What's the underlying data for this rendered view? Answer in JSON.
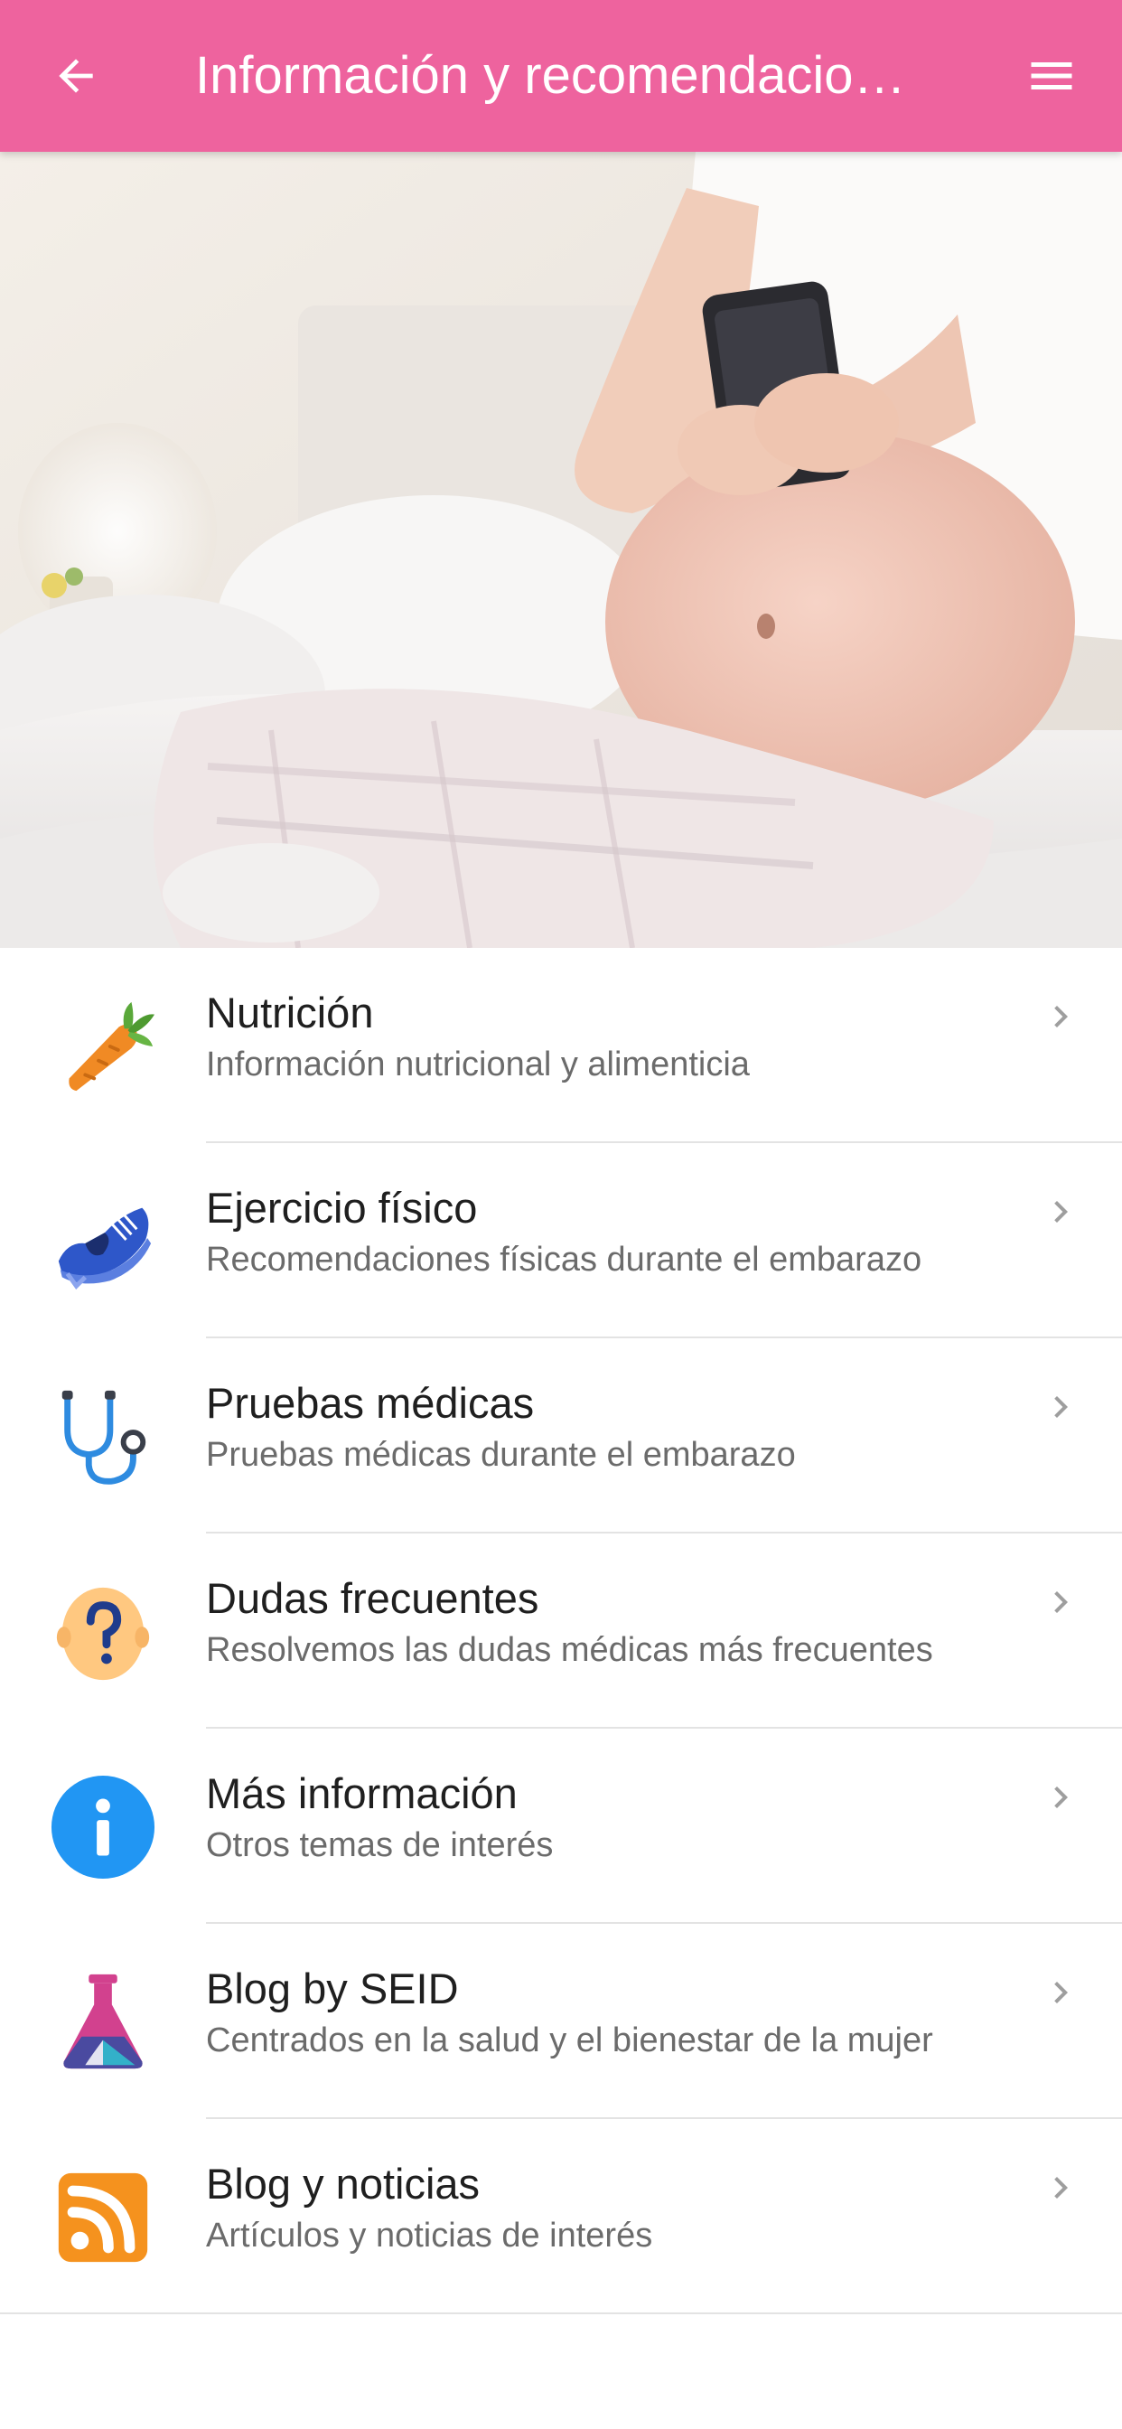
{
  "appbar": {
    "title": "Información y recomendaciones",
    "back_icon": "arrow-back-icon",
    "menu_icon": "hamburger-menu-icon",
    "color": "#EE639E"
  },
  "hero": {
    "subject": "pregnant woman sitting on bed using smartphone"
  },
  "items": [
    {
      "title": "Nutrición",
      "subtitle": "Información nutricional y alimenticia",
      "icon": "carrot-icon"
    },
    {
      "title": "Ejercicio físico",
      "subtitle": "Recomendaciones físicas durante el embarazo",
      "icon": "sneaker-icon"
    },
    {
      "title": "Pruebas médicas",
      "subtitle": "Pruebas médicas durante el embarazo",
      "icon": "stethoscope-icon"
    },
    {
      "title": "Dudas frecuentes",
      "subtitle": "Resolvemos las dudas médicas más frecuentes",
      "icon": "question-head-icon"
    },
    {
      "title": "Más información",
      "subtitle": "Otros temas de interés",
      "icon": "info-icon"
    },
    {
      "title": "Blog by SEID",
      "subtitle": "Centrados en la salud y el bienestar de la mujer",
      "icon": "seid-flask-icon"
    },
    {
      "title": "Blog y noticias",
      "subtitle": "Artículos y noticias de interés",
      "icon": "rss-feed-icon"
    }
  ],
  "colors": {
    "chevron": "#9e9e9e",
    "title_text": "#1f1f1f",
    "subtitle_text": "#6b6b6b"
  }
}
